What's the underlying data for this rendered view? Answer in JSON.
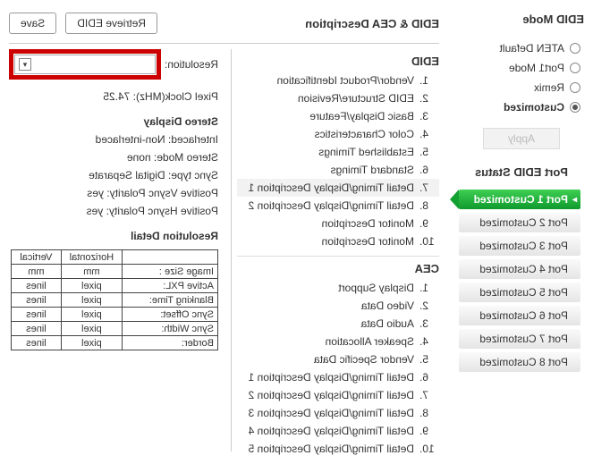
{
  "left": {
    "mode_header": "EDID Mode",
    "radios": [
      {
        "label": "ATEN Default",
        "selected": false
      },
      {
        "label": "Port1 Mode",
        "selected": false
      },
      {
        "label": "Remix",
        "selected": false
      },
      {
        "label": "Customized",
        "selected": true
      }
    ],
    "apply_label": "Apply",
    "status_header": "Port EDID Status",
    "ports": [
      {
        "label": "Port 1  Customized",
        "active": true
      },
      {
        "label": "Port 2  Customized",
        "active": false
      },
      {
        "label": "Port 3  Customized",
        "active": false
      },
      {
        "label": "Port 4  Customized",
        "active": false
      },
      {
        "label": "Port 5  Customized",
        "active": false
      },
      {
        "label": "Port 6  Customized",
        "active": false
      },
      {
        "label": "Port 7  Customized",
        "active": false
      },
      {
        "label": "Port 8  Customized",
        "active": false
      }
    ]
  },
  "toolbar": {
    "title": "EDID & CEA Description",
    "retrieve": "Retrieve EDID",
    "save": "Save"
  },
  "mid": {
    "edid_header": "EDID",
    "edid_items": [
      "Vendor/Product Identification",
      "EDID Structure/Revision",
      "Basic Display/Feature",
      "Color Characteristics",
      "Established Timings",
      "Standard Timings",
      "Detail Timing/Display Description 1",
      "Detail Timing/Display Description 2",
      "Monitor Description",
      "Monitor Description"
    ],
    "edid_selected_index": 6,
    "cea_header": "CEA",
    "cea_items": [
      "Display Support",
      "Video Data",
      "Audio Data",
      "Speaker Allocation",
      "Vendor Specific Data",
      "Detail Timing/Display Description 1",
      "Detail Timing/Display Description 2",
      "Detail Timing/Display Description 3",
      "Detail Timing/Display Description 4",
      "Detail Timing/Display Description 5"
    ]
  },
  "detail": {
    "resolution_label": "Resolution:",
    "pixel_clock": "Pixel Clock(MHz): 74.25",
    "stereo_header": "Stereo Display",
    "stereo_lines": [
      "Interlaced: Non-interlaced",
      "Stereo Mode: none",
      "Sync type: Digital Separate",
      "Positive Vsync Polarity: yes",
      "Positive Hsync Polarity: yes"
    ],
    "res_detail_header": "Resolution Detail",
    "table": {
      "head": [
        "",
        "Horizontal",
        "Vertical"
      ],
      "rows": [
        [
          "Image Size :",
          "mm",
          "mm"
        ],
        [
          "Active PXL:",
          "pixel",
          "lines"
        ],
        [
          "Blanking Time:",
          "pixel",
          "lines"
        ],
        [
          "Sync Offset:",
          "pixel",
          "lines"
        ],
        [
          "Sync Width:",
          "pixel",
          "lines"
        ],
        [
          "Border:",
          "pixel",
          "lines"
        ]
      ]
    }
  }
}
